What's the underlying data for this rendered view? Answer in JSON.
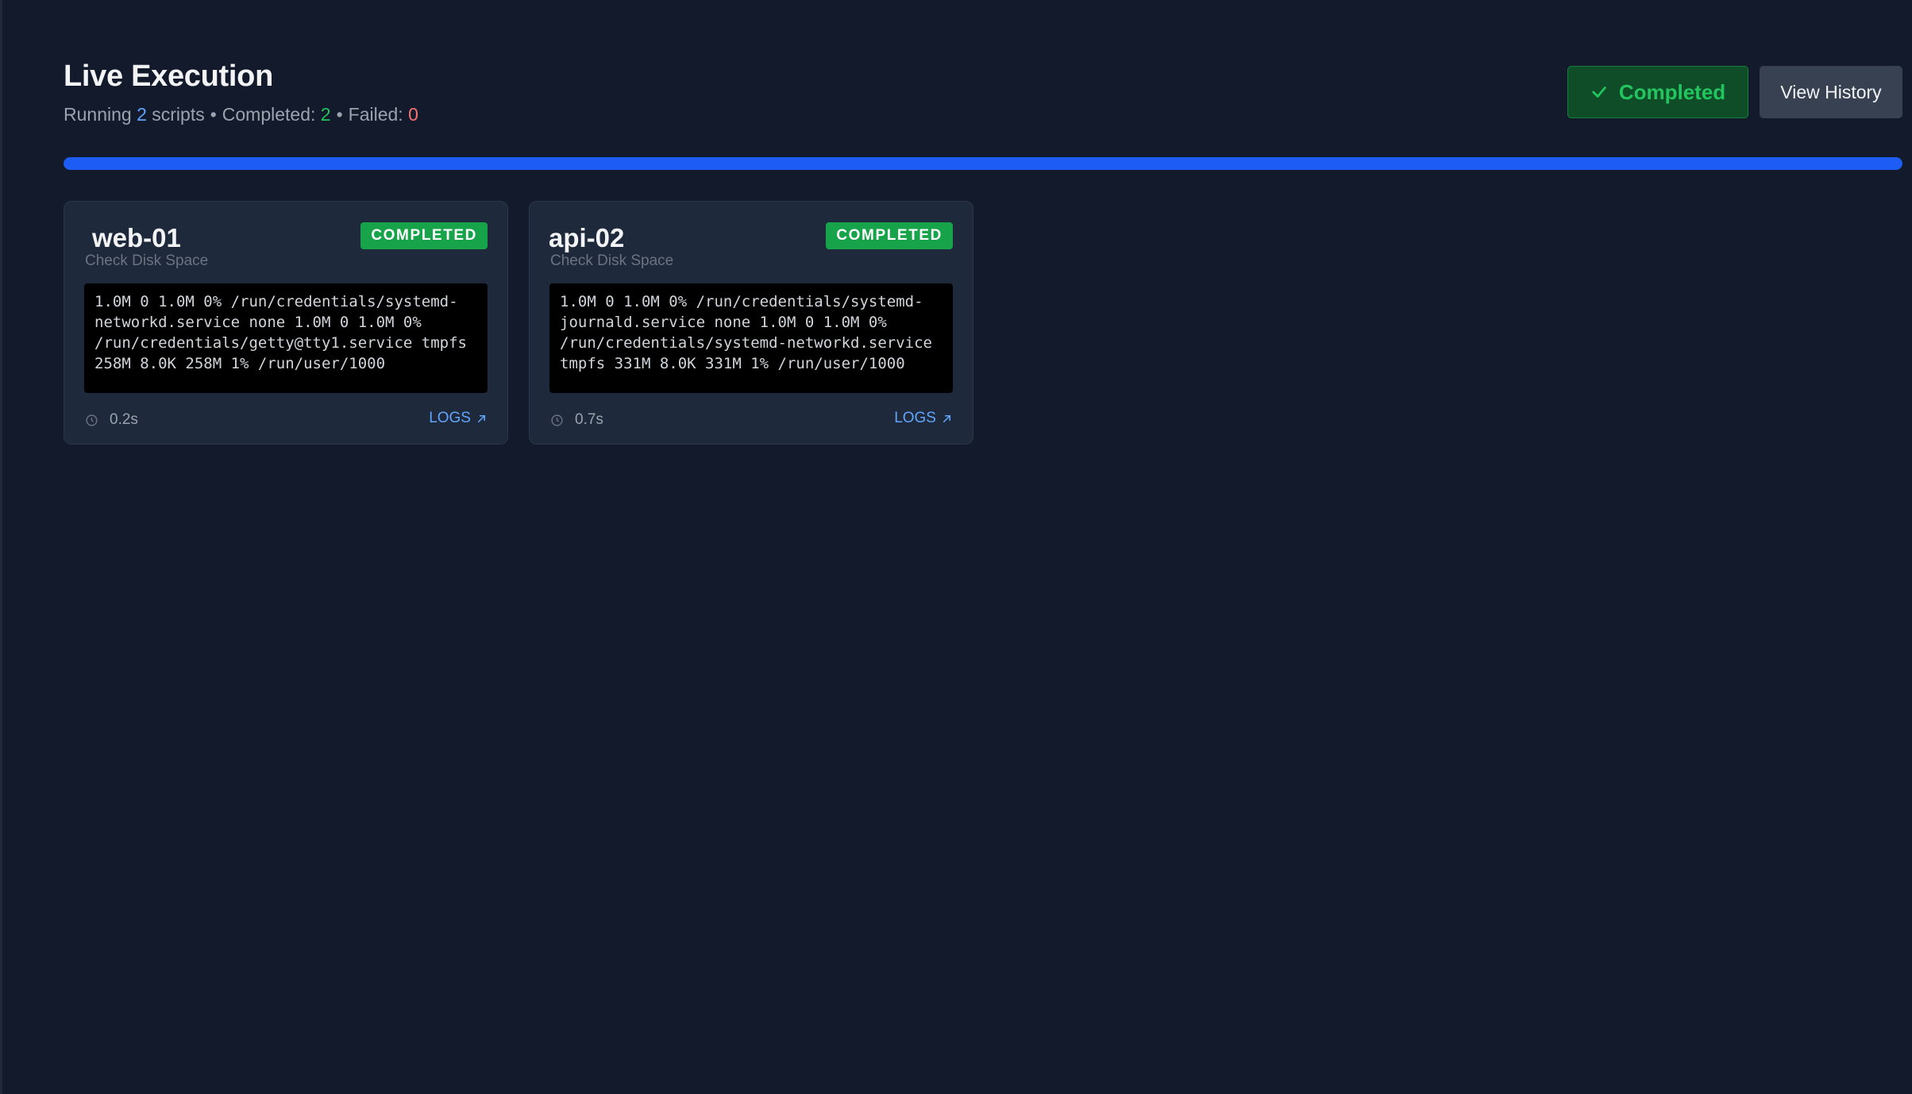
{
  "header": {
    "title": "Live Execution",
    "running_prefix": "Running",
    "running_count": "2",
    "running_suffix": "scripts",
    "separator": "•",
    "completed_label": "Completed:",
    "completed_count": "2",
    "failed_label": "Failed:",
    "failed_count": "0"
  },
  "actions": {
    "status_label": "Completed",
    "status_icon": "check-icon",
    "history_label": "View History"
  },
  "progress": {
    "percent": 100
  },
  "cards": [
    {
      "host": "web-01",
      "script": "Check Disk Space",
      "status": "COMPLETED",
      "output": "1.0M 0 1.0M 0% /run/credentials/systemd-\nnetworkd.service none 1.0M 0 1.0M 0%\n/run/credentials/getty@tty1.service tmpfs\n258M 8.0K 258M 1% /run/user/1000",
      "duration": "0.2s",
      "logs_label": "LOGS"
    },
    {
      "host": "api-02",
      "script": "Check Disk Space",
      "status": "COMPLETED",
      "output": "1.0M 0 1.0M 0% /run/credentials/systemd-\njournald.service none 1.0M 0 1.0M 0%\n/run/credentials/systemd-networkd.service\ntmpfs 331M 8.0K 331M 1% /run/user/1000",
      "duration": "0.7s",
      "logs_label": "LOGS"
    }
  ],
  "colors": {
    "background": "#121a2b",
    "accent_blue": "#1d5cf5",
    "success_green": "#16a34a",
    "failed_red": "#f87171"
  }
}
